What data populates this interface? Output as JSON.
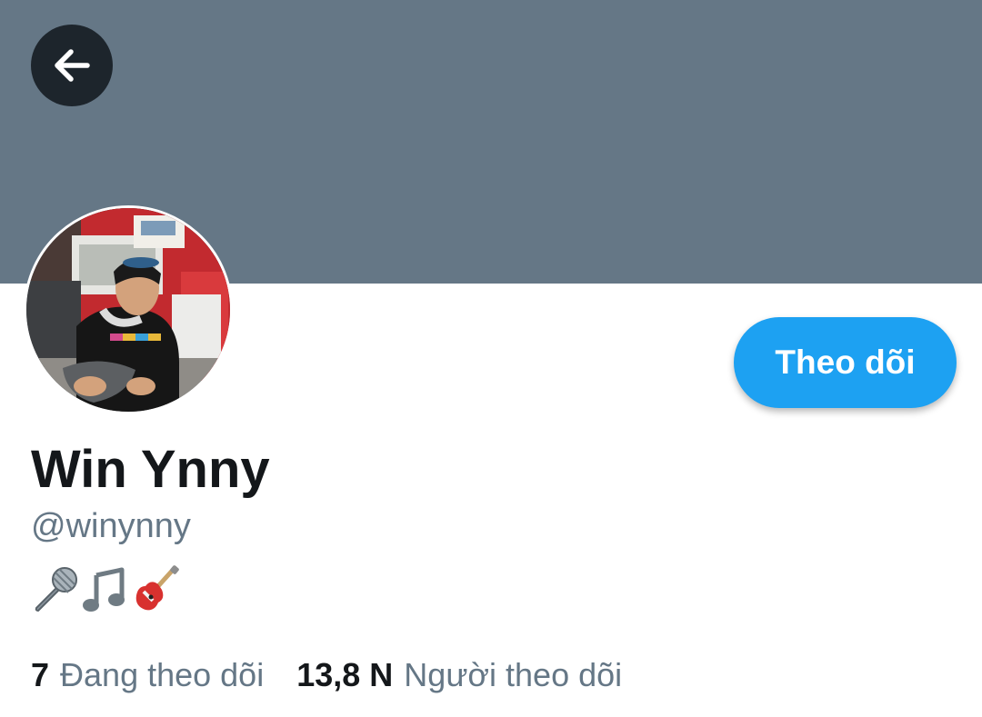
{
  "header": {
    "back_icon": "arrow-left-icon",
    "banner_color": "#657786"
  },
  "profile": {
    "avatar_icon": "profile-photo",
    "display_name": "Win Ynny",
    "handle": "@winynny",
    "bio_emojis": [
      "microphone-icon",
      "musical-note-icon",
      "guitar-icon"
    ]
  },
  "actions": {
    "follow_label": "Theo dõi",
    "follow_color": "#1da1f2"
  },
  "stats": {
    "following_count": "7",
    "following_label": "Đang theo dõi",
    "followers_count": "13,8 N",
    "followers_label": "Người theo dõi"
  },
  "colors": {
    "text_primary": "#14171a",
    "text_secondary": "#657786"
  }
}
